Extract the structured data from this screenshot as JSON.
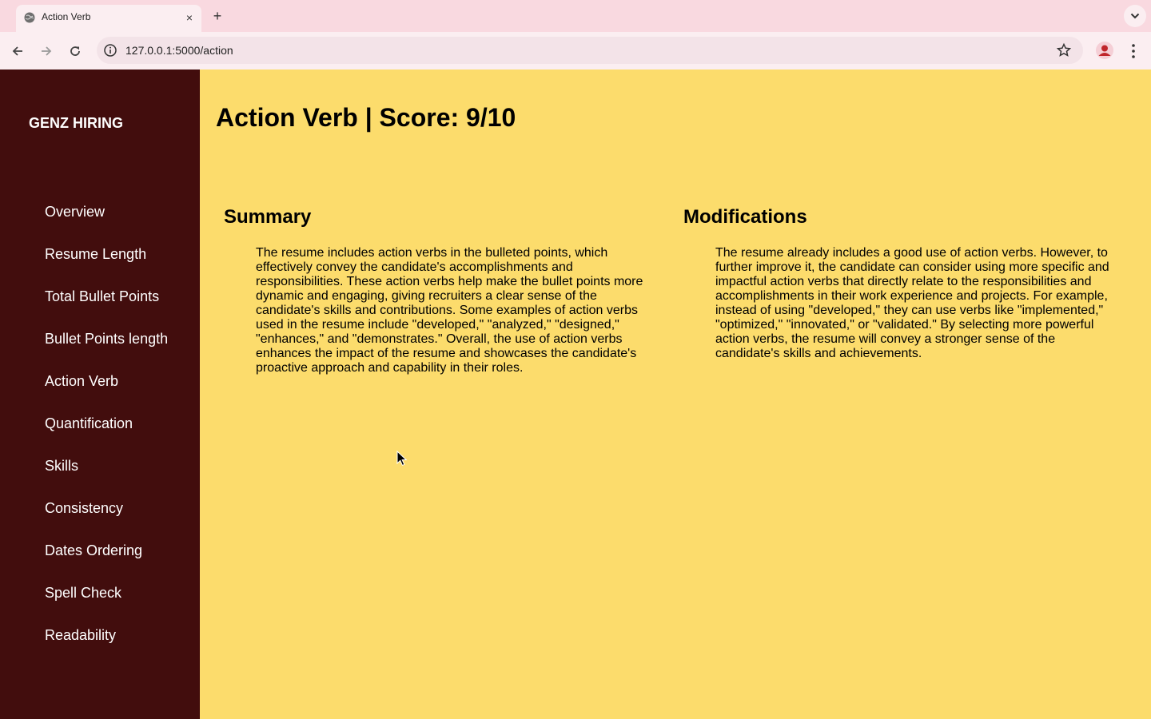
{
  "browser": {
    "tab_title": "Action Verb",
    "tab_close": "×",
    "new_tab": "+",
    "url": "127.0.0.1:5000/action"
  },
  "sidebar": {
    "brand": "GENZ HIRING",
    "items": [
      {
        "label": "Overview"
      },
      {
        "label": "Resume Length"
      },
      {
        "label": "Total Bullet Points"
      },
      {
        "label": "Bullet Points length"
      },
      {
        "label": "Action Verb"
      },
      {
        "label": "Quantification"
      },
      {
        "label": "Skills"
      },
      {
        "label": "Consistency"
      },
      {
        "label": "Dates Ordering"
      },
      {
        "label": "Spell Check"
      },
      {
        "label": "Readability"
      }
    ]
  },
  "main": {
    "title": "Action Verb | Score: 9/10",
    "summary": {
      "heading": "Summary",
      "text": "The resume includes action verbs in the bulleted points, which effectively convey the candidate's accomplishments and responsibilities. These action verbs help make the bullet points more dynamic and engaging, giving recruiters a clear sense of the candidate's skills and contributions. Some examples of action verbs used in the resume include \"developed,\" \"analyzed,\" \"designed,\" \"enhances,\" and \"demonstrates.\" Overall, the use of action verbs enhances the impact of the resume and showcases the candidate's proactive approach and capability in their roles."
    },
    "modifications": {
      "heading": "Modifications",
      "text": "The resume already includes a good use of action verbs. However, to further improve it, the candidate can consider using more specific and impactful action verbs that directly relate to the responsibilities and accomplishments in their work experience and projects. For example, instead of using \"developed,\" they can use verbs like \"implemented,\" \"optimized,\" \"innovated,\" or \"validated.\" By selecting more powerful action verbs, the resume will convey a stronger sense of the candidate's skills and achievements."
    }
  },
  "colors": {
    "sidebar_bg": "#420d0d",
    "main_bg": "#fcdc6c",
    "tabbar_bg": "#f9d9e0",
    "toolbar_bg": "#fbeef1"
  }
}
